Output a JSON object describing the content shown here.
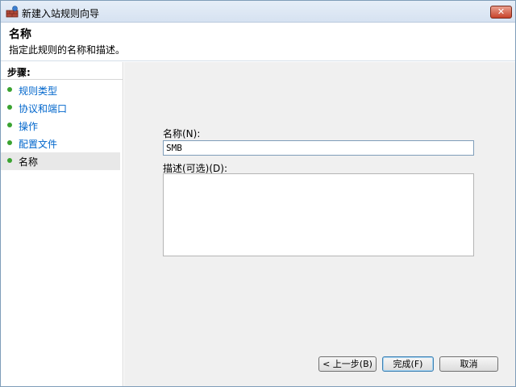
{
  "window": {
    "title": "新建入站规则向导",
    "close_glyph": "✕"
  },
  "header": {
    "title": "名称",
    "description": "指定此规则的名称和描述。"
  },
  "steps": {
    "heading": "步骤:",
    "items": [
      {
        "label": "规则类型"
      },
      {
        "label": "协议和端口"
      },
      {
        "label": "操作"
      },
      {
        "label": "配置文件"
      },
      {
        "label": "名称"
      }
    ]
  },
  "form": {
    "name_label": "名称(N):",
    "name_value": "SMB",
    "description_label": "描述(可选)(D):",
    "description_value": ""
  },
  "buttons": {
    "back": "< 上一步(B)",
    "finish": "完成(F)",
    "cancel": "取消"
  },
  "colors": {
    "step_dot": "#3aa330",
    "step_link": "#0066cc",
    "content_bg": "#f0f0f0"
  },
  "icons": {
    "app": "firewall-wall-icon",
    "step": "green-dot-icon"
  }
}
